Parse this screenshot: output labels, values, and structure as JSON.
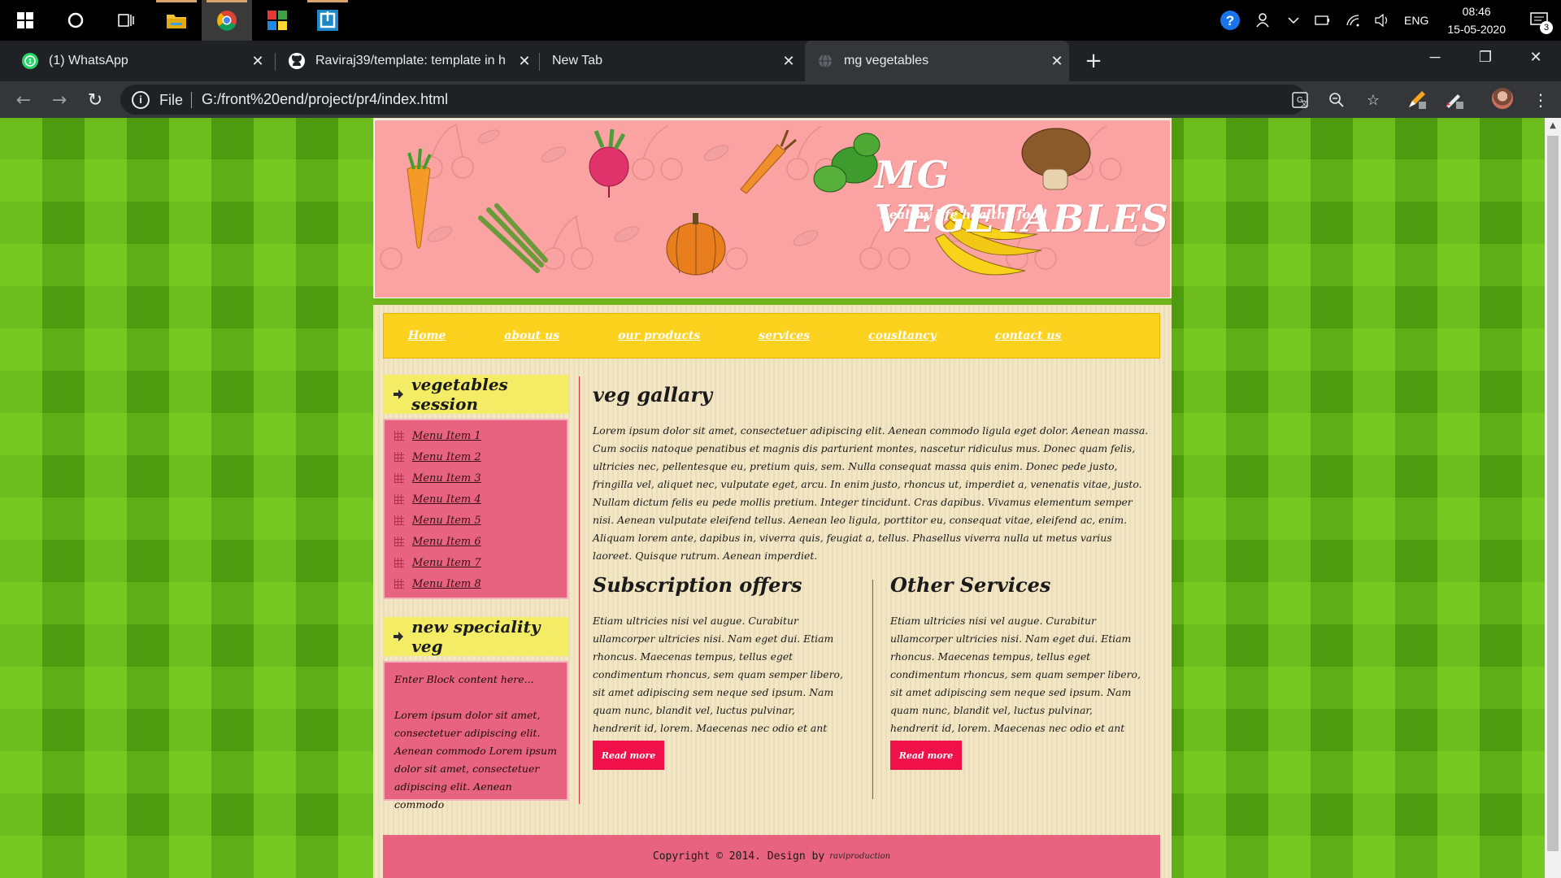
{
  "taskbar": {
    "language": "ENG",
    "time": "08:46",
    "date": "15-05-2020",
    "notification_count": "3"
  },
  "browser": {
    "tabs": [
      {
        "label": "(1) WhatsApp",
        "icon": "whatsapp-icon"
      },
      {
        "label": "Raviraj39/template: template in h",
        "icon": "github-icon"
      },
      {
        "label": "New Tab",
        "icon": ""
      },
      {
        "label": "mg vegetables",
        "icon": "globe-icon"
      }
    ],
    "omnibox": {
      "scheme_label": "File",
      "url": "G:/front%20end/project/pr4/index.html"
    }
  },
  "page": {
    "site_title": "MG VEGETABLES",
    "tagline": "healthy life healthy food",
    "nav": [
      "Home",
      "about us",
      "our products",
      "services",
      "cousltancy",
      "contact us"
    ],
    "sidebar": {
      "heading1": "vegetables session",
      "menu": [
        "Menu Item 1",
        "Menu Item 2",
        "Menu Item 3",
        "Menu Item 4",
        "Menu Item 5",
        "Menu Item 6",
        "Menu Item 7",
        "Menu Item 8"
      ],
      "heading2": "new speciality veg",
      "block_intro": "Enter Block content here...",
      "block_text": "Lorem ipsum dolor sit amet, consectetuer adipiscing elit. Aenean commodo Lorem ipsum dolor sit amet, consectetuer adipiscing elit. Aenean commodo"
    },
    "main": {
      "heading": "veg gallary",
      "intro": "Lorem ipsum dolor sit amet, consectetuer adipiscing elit. Aenean commodo ligula eget dolor. Aenean massa. Cum sociis natoque penatibus et magnis dis parturient montes, nascetur ridiculus mus. Donec quam felis, ultricies nec, pellentesque eu, pretium quis, sem. Nulla consequat massa quis enim. Donec pede justo, fringilla vel, aliquet nec, vulputate eget, arcu. In enim justo, rhoncus ut, imperdiet a, venenatis vitae, justo. Nullam dictum felis eu pede mollis pretium. Integer tincidunt. Cras dapibus. Vivamus elementum semper nisi. Aenean vulputate eleifend tellus. Aenean leo ligula, porttitor eu, consequat vitae, eleifend ac, enim. Aliquam lorem ante, dapibus in, viverra quis, feugiat a, tellus. Phasellus viverra nulla ut metus varius laoreet. Quisque rutrum. Aenean imperdiet.",
      "col1_heading": "Subscription offers",
      "col1_text": "Etiam ultricies nisi vel augue. Curabitur ullamcorper ultricies nisi. Nam eget dui. Etiam rhoncus. Maecenas tempus, tellus eget condimentum rhoncus, sem quam semper libero, sit amet adipiscing sem neque sed ipsum. Nam quam nunc, blandit vel, luctus pulvinar, hendrerit id, lorem. Maecenas nec odio et ant",
      "col1_button": "Read more",
      "col2_heading": "Other Services",
      "col2_text": "Etiam ultricies nisi vel augue. Curabitur ullamcorper ultricies nisi. Nam eget dui. Etiam rhoncus. Maecenas tempus, tellus eget condimentum rhoncus, sem quam semper libero, sit amet adipiscing sem neque sed ipsum. Nam quam nunc, blandit vel, luctus pulvinar, hendrerit id, lorem. Maecenas nec odio et ant",
      "col2_button": "Read more"
    },
    "footer": {
      "copyright": "Copyright © 2014. Design by",
      "credit": "raviproduction"
    }
  },
  "colors": {
    "page_green": "#5aa813",
    "banner_pink": "#fba3a3",
    "nav_yellow": "#fdd21f",
    "sidebar_pink": "#e8637f",
    "button_red": "#f0104a"
  }
}
